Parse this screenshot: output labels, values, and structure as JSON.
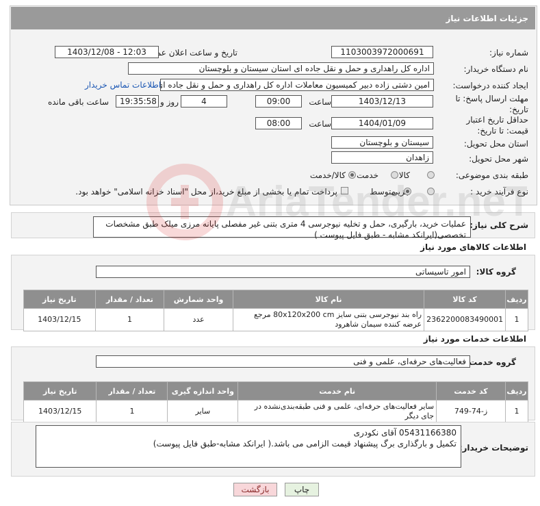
{
  "header": {
    "title": "جزئیات اطلاعات نیاز"
  },
  "form": {
    "need_number_label": "شماره نیاز:",
    "need_number": "1103003972000691",
    "announce_label": "تاریخ و ساعت اعلان عمومی:",
    "announce_value": "1403/12/08 - 12:03",
    "buyer_org_label": "نام دستگاه خریدار:",
    "buyer_org": "اداره کل راهداری و حمل و نقل جاده ای استان سیستان و بلوچستان",
    "requester_label": "ایجاد کننده درخواست:",
    "requester": "امین دشتی زاده دبیر کمیسیون معاملات اداره کل راهداری و حمل و نقل جاده ای",
    "buyer_contact_link": "اطلاعات تماس خریدار",
    "reply_deadline_label": "مهلت ارسال پاسخ: تا تاریخ:",
    "reply_date": "1403/12/13",
    "time_label": "ساعت",
    "reply_time": "09:00",
    "days_value": "4",
    "days_label": "روز و",
    "remaining_time": "19:35:58",
    "remaining_label": "ساعت باقی مانده",
    "price_valid_label": "حداقل تاریخ اعتبار قیمت: تا تاریخ:",
    "price_valid_date": "1404/01/09",
    "price_valid_time_label": "ساعت",
    "price_valid_time": "08:00",
    "province_label": "استان محل تحویل:",
    "province": "سیستان و بلوچستان",
    "city_label": "شهر محل تحویل:",
    "city": "زاهدان",
    "category_label": "طبقه بندی موضوعی:",
    "category_options": [
      "کالا",
      "خدمت",
      "کالا/خدمت"
    ],
    "process_label": "نوع فرآیند خرید :",
    "process_options": [
      "جزیی",
      "متوسط"
    ],
    "payment_note": "پرداخت تمام یا بخشی از مبلغ خرید،از محل \"اسناد خزانه اسلامی\" خواهد بود."
  },
  "summary": {
    "label": "شرح کلی نیاز:",
    "text": "عملیات خرید، بارگیری، حمل و تخلیه نیوجرسی 4 متری بتنی غیر مفصلی پایانه مرزی میلک طبق مشخصات تخصصی(ایرانکد مشابه - طبق فایل پیوست )"
  },
  "goods": {
    "section_title": "اطلاعات کالاهای مورد نیاز",
    "group_label": "گروه کالا:",
    "group_value": "امور تاسیساتی",
    "headers": [
      "ردیف",
      "کد کالا",
      "نام کالا",
      "واحد شمارش",
      "تعداد / مقدار",
      "تاریخ نیاز"
    ],
    "rows": [
      [
        "1",
        "2362200083490001",
        "راه بند نیوجرسی بتنی سایز 80x120x200 cm مرجع عرضه کننده سیمان شاهرود",
        "عدد",
        "1",
        "1403/12/15"
      ]
    ]
  },
  "services": {
    "section_title": "اطلاعات خدمات مورد نیاز",
    "group_label": "گروه خدمت:",
    "group_value": "فعالیت‌های حرفه‌ای، علمی و فنی",
    "headers": [
      "ردیف",
      "کد خدمت",
      "نام خدمت",
      "واحد اندازه گیری",
      "تعداد / مقدار",
      "تاریخ نیاز"
    ],
    "rows": [
      [
        "1",
        "ز-74-749",
        "سایر فعالیت‌های حرفه‌ای، علمی و فنی طبقه‌بندی‌نشده در جای دیگر",
        "سایر",
        "1",
        "1403/12/15"
      ]
    ]
  },
  "buyer_notes": {
    "label": "توضیحات خریدار:",
    "line1": "05431166380 آقای نکودری",
    "line2": "تکمیل و بارگذاری برگ پیشنهاد قیمت الزامی می باشد.( ایرانکد مشابه-طبق فایل پیوست)"
  },
  "buttons": {
    "print": "چاپ",
    "back": "بازگشت"
  },
  "watermark": {
    "text": "AriaTender.neT"
  },
  "colors": {
    "header_bg": "#9a9a9a",
    "link": "#1a56b3",
    "back_button_bg": "#f8d7da",
    "print_button_bg": "#e6f2e0"
  }
}
